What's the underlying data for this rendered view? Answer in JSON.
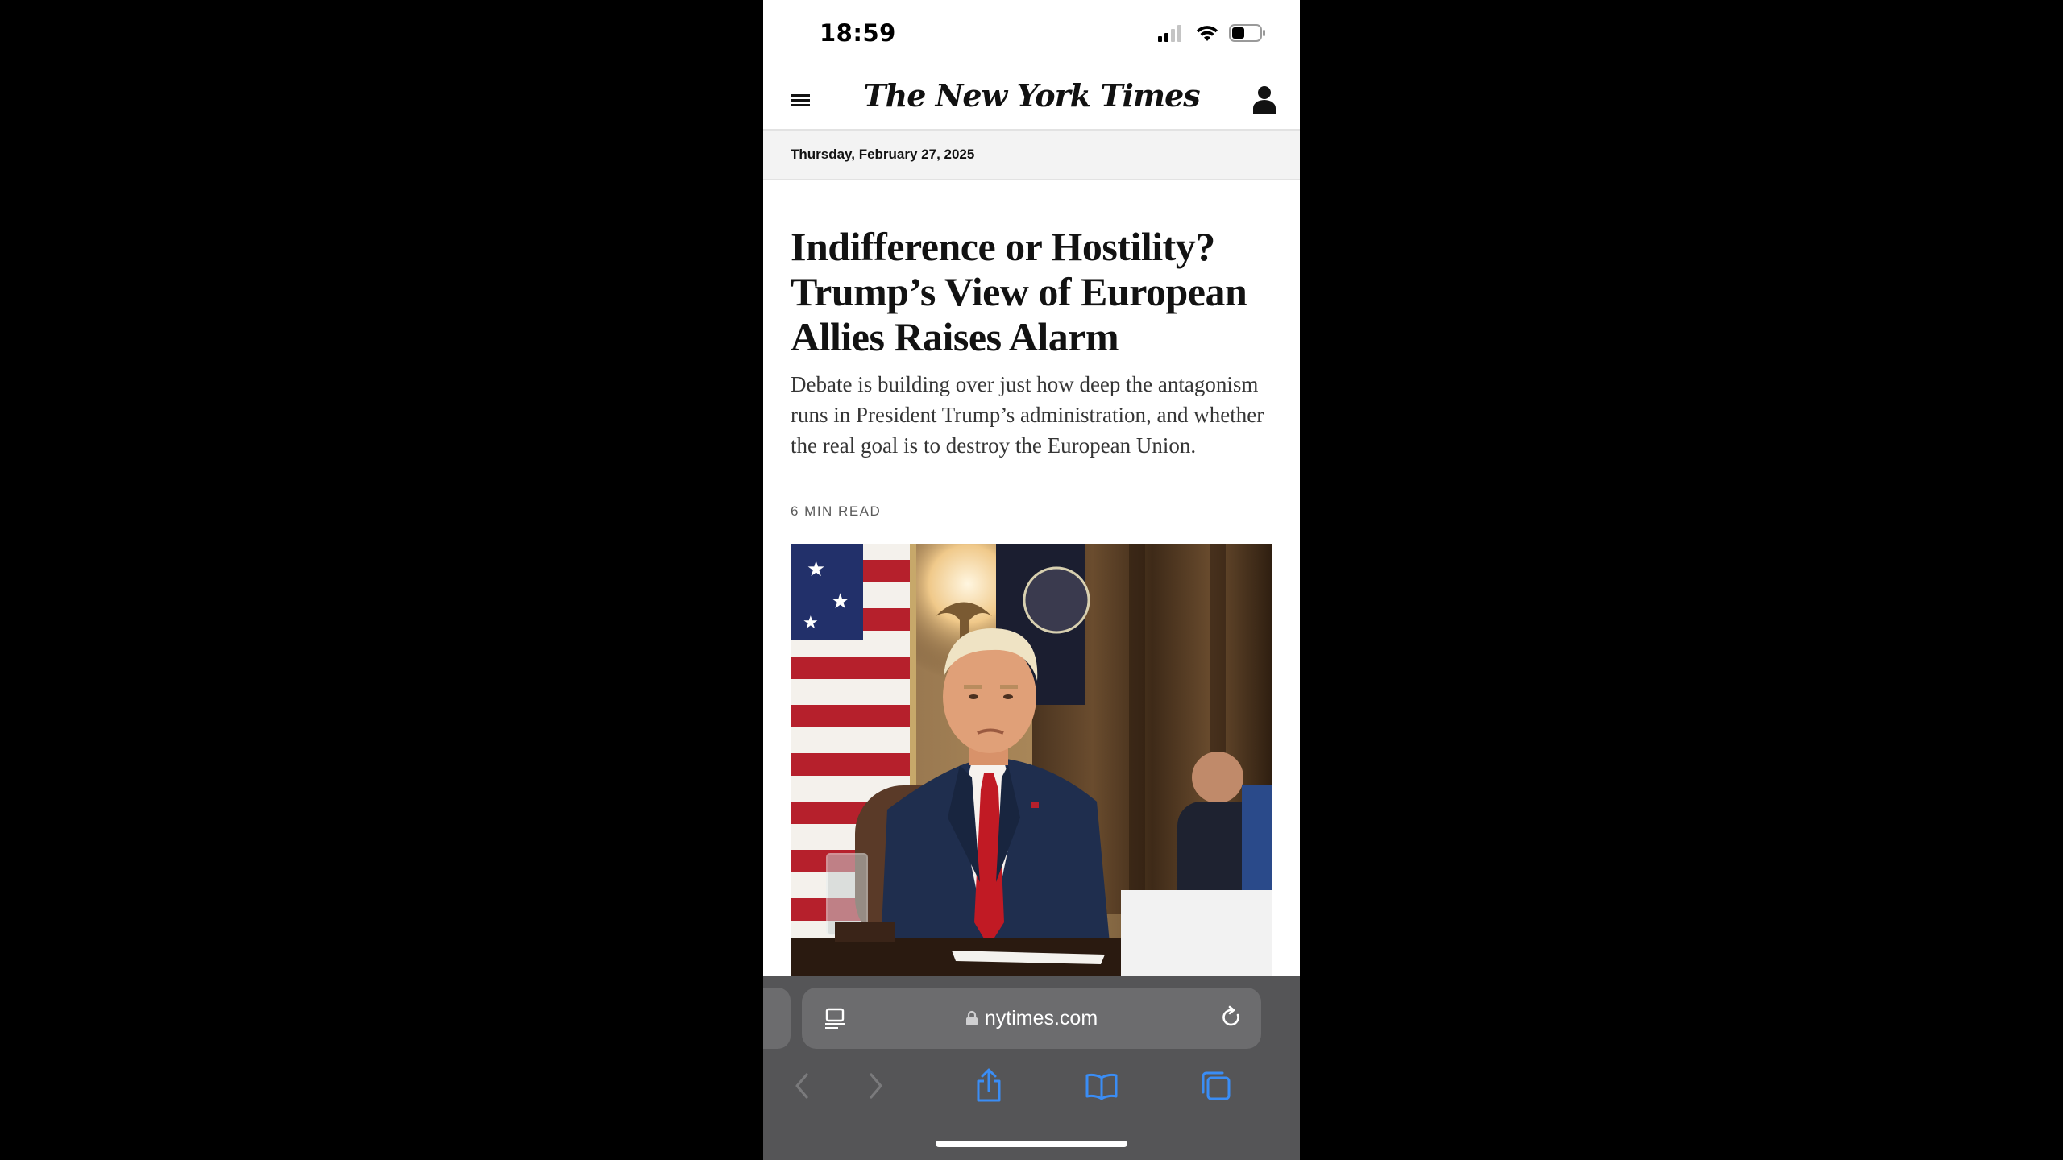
{
  "status_bar": {
    "time": "18:59",
    "icons": [
      "cellular-signal-icon",
      "wifi-icon",
      "battery-icon"
    ]
  },
  "header": {
    "menu_icon": "hamburger-menu-icon",
    "logo_text": "The New York Times",
    "account_icon": "account-icon"
  },
  "date_bar": {
    "date": "Thursday, February 27, 2025"
  },
  "article": {
    "headline": "Indifference or Hostility? Trump’s View of European Allies Raises Alarm",
    "summary": "Debate is building over just how deep the antagonism runs in President Trump’s administration, and whether the real goal is to destroy the European Union.",
    "read_time": "6 MIN READ",
    "image_icon": "article-photo"
  },
  "safari": {
    "url": "nytimes.com",
    "reader_icon": "reader-mode-icon",
    "lock_icon": "lock-icon",
    "reload_icon": "reload-icon",
    "toolbar": [
      "back-icon",
      "forward-icon",
      "share-icon",
      "bookmarks-icon",
      "tabs-icon"
    ],
    "colors": {
      "toolbar_bg": "#555557",
      "address_bg": "#6c6c6e",
      "active_icon": "#3a8df5",
      "disabled_icon": "#7a7a7c"
    }
  }
}
